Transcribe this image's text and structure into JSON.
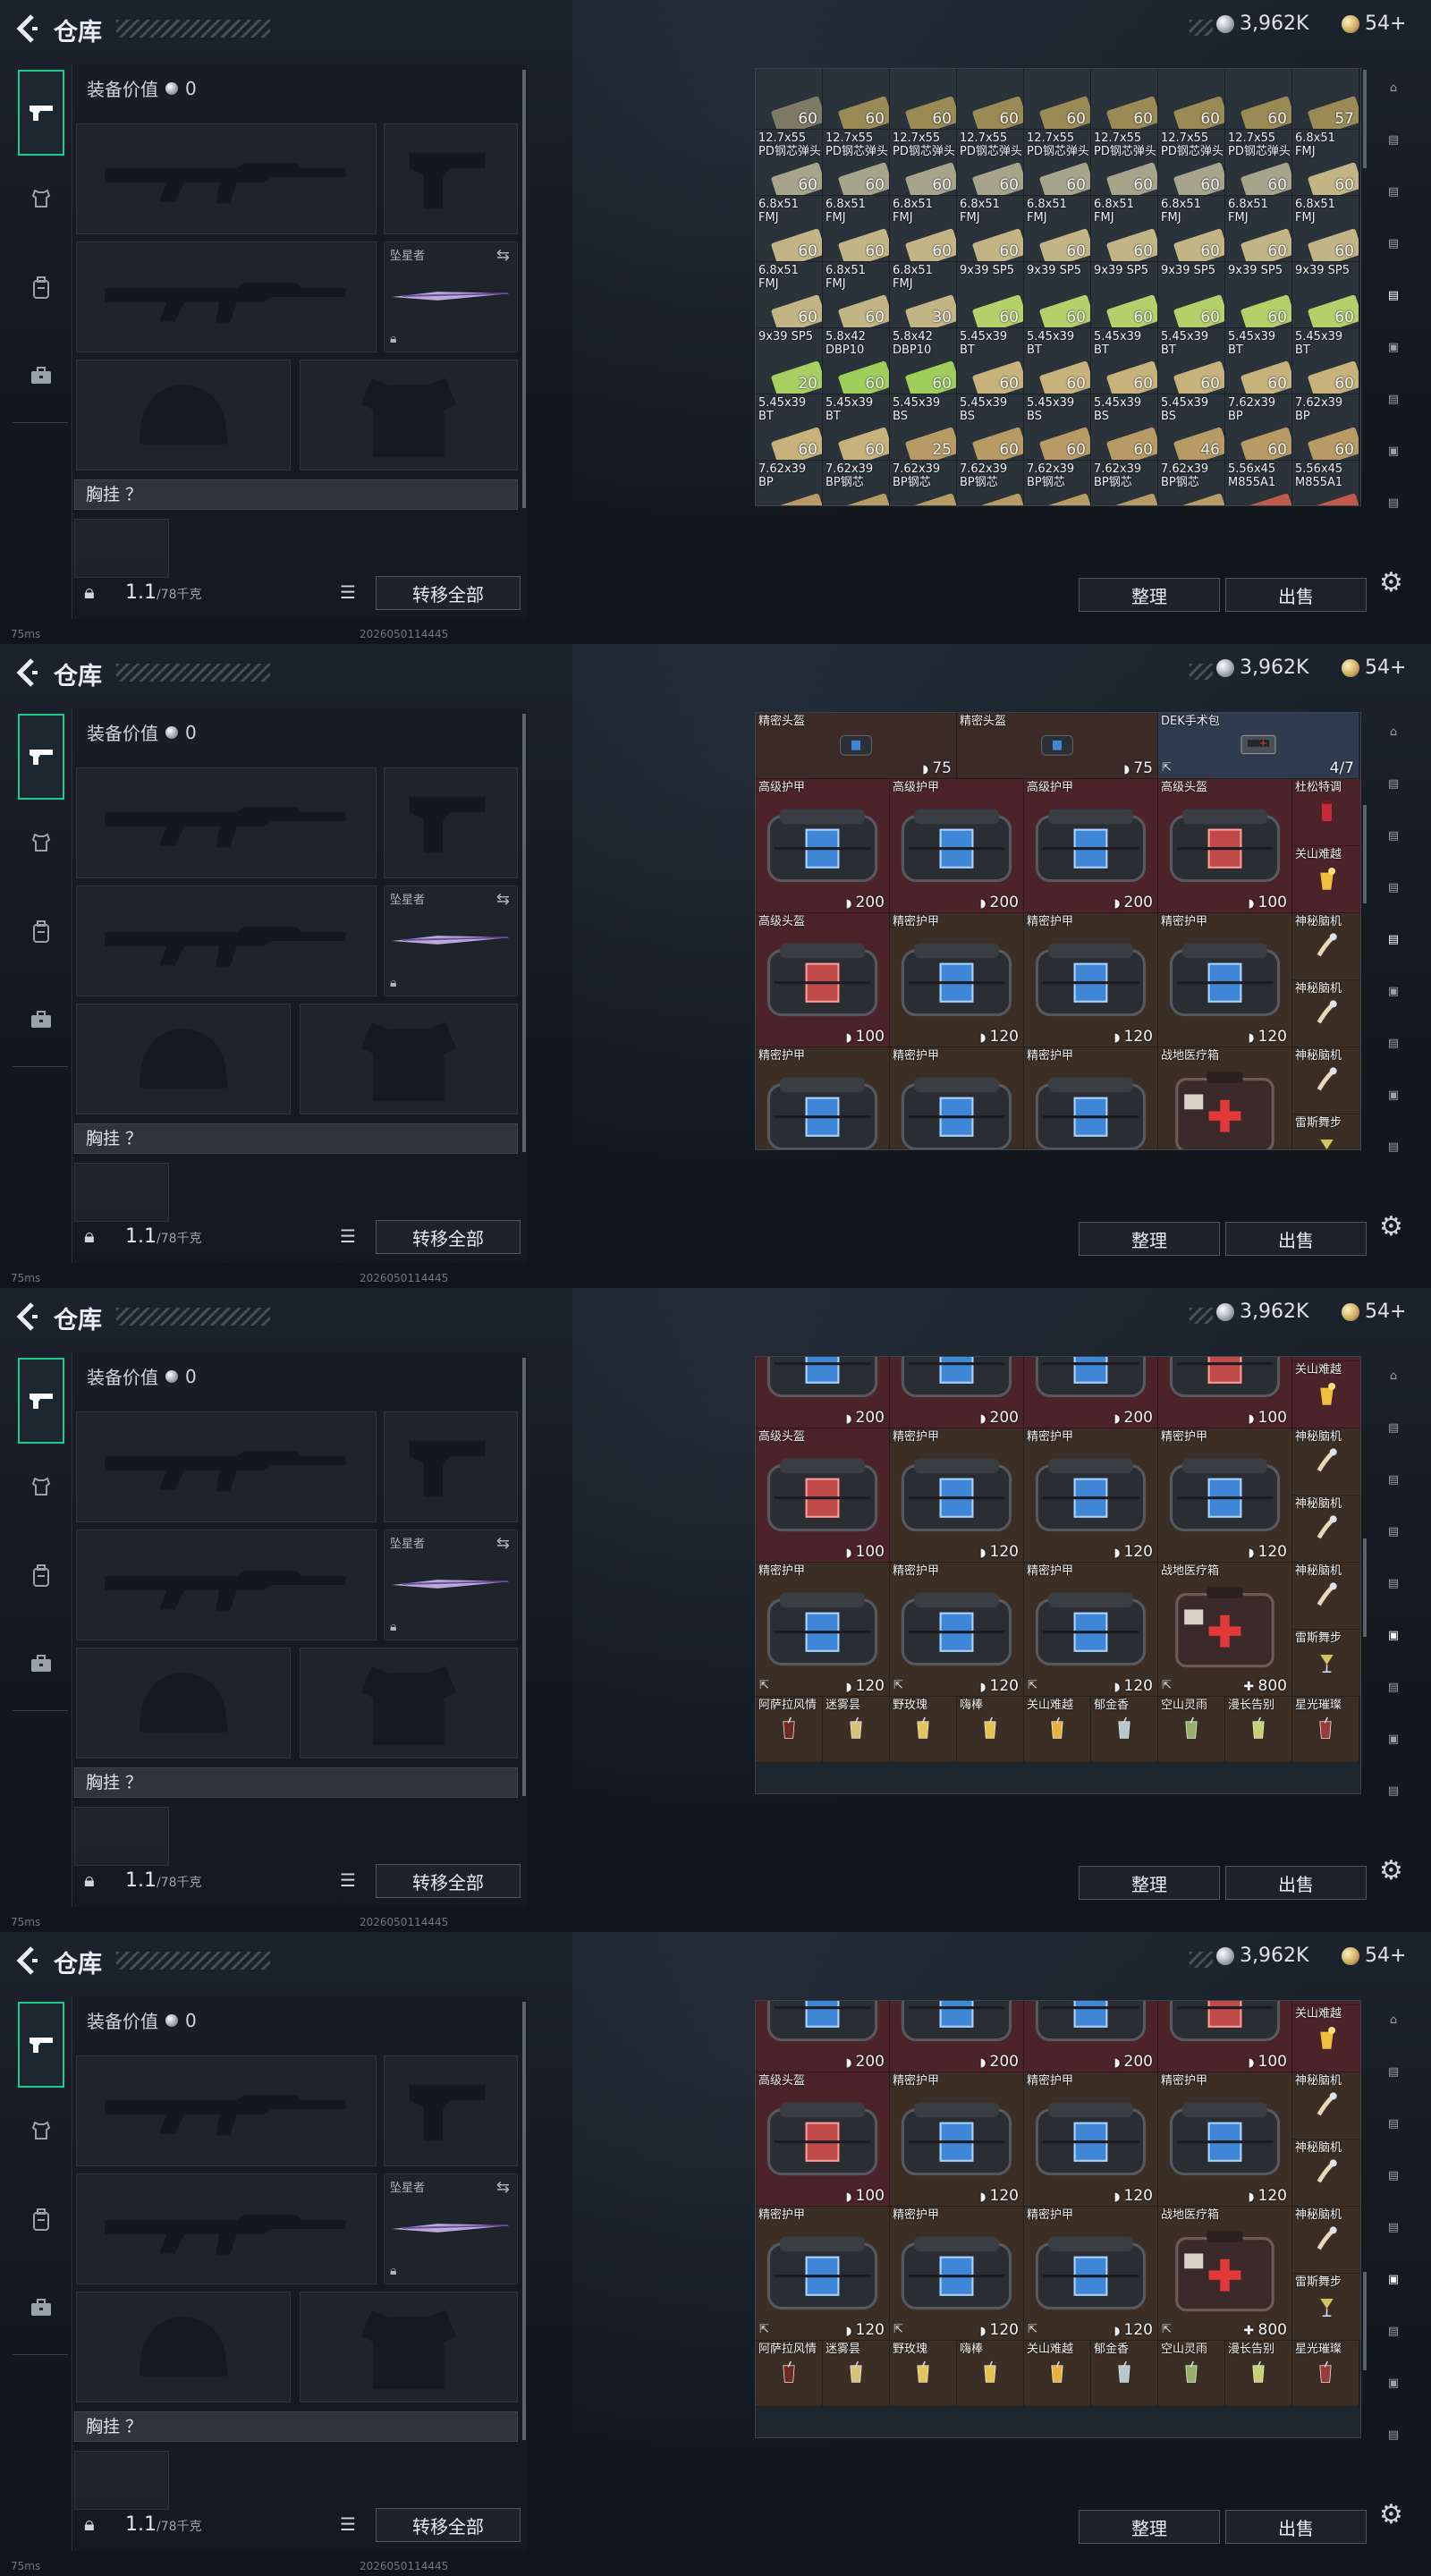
{
  "topbar": {
    "title": "仓库",
    "currency1": "3,962K",
    "currency2": "54+"
  },
  "equipment": {
    "value_label": "装备价值",
    "value": "0",
    "melee_name": "坠星者",
    "chest_label": "胸挂 ？",
    "weight": "1.1",
    "weight_max": "/78千克",
    "transfer_all": "转移全部"
  },
  "status": {
    "ping": "75ms",
    "version": "2026050114445"
  },
  "actions": {
    "sort": "整理",
    "sell": "出售"
  },
  "frames": [
    {
      "grid_kind": "ammo",
      "ammo_rows": [
        [
          {
            "n": "",
            "q": "60",
            "c": "#7d7a66"
          },
          {
            "n": "",
            "q": "60",
            "c": "#9a8a55"
          },
          {
            "n": "",
            "q": "60",
            "c": "#9a8a55"
          },
          {
            "n": "",
            "q": "60",
            "c": "#9a8a55"
          },
          {
            "n": "",
            "q": "60",
            "c": "#9a8a55"
          },
          {
            "n": "",
            "q": "60",
            "c": "#9a8a55"
          },
          {
            "n": "",
            "q": "60",
            "c": "#9a8a55"
          },
          {
            "n": "",
            "q": "60",
            "c": "#9a8a55"
          },
          {
            "n": "",
            "q": "57",
            "c": "#9a8a55"
          }
        ],
        [
          {
            "n": "12.7x55 PD钢芯弹头",
            "q": "60",
            "c": "#a7a48c"
          },
          {
            "n": "12.7x55 PD钢芯弹头",
            "q": "60",
            "c": "#a7a48c"
          },
          {
            "n": "12.7x55 PD钢芯弹头",
            "q": "60",
            "c": "#a7a48c"
          },
          {
            "n": "12.7x55 PD钢芯弹头",
            "q": "60",
            "c": "#a7a48c"
          },
          {
            "n": "12.7x55 PD钢芯弹头",
            "q": "60",
            "c": "#a7a48c"
          },
          {
            "n": "12.7x55 PD钢芯弹头",
            "q": "60",
            "c": "#a7a48c"
          },
          {
            "n": "12.7x55 PD钢芯弹头",
            "q": "60",
            "c": "#a7a48c"
          },
          {
            "n": "12.7x55 PD钢芯弹头",
            "q": "60",
            "c": "#a7a48c"
          },
          {
            "n": "6.8x51 FMJ",
            "q": "60",
            "c": "#c2b484"
          }
        ],
        [
          {
            "n": "6.8x51 FMJ",
            "q": "60",
            "c": "#c2b484"
          },
          {
            "n": "6.8x51 FMJ",
            "q": "60",
            "c": "#c2b484"
          },
          {
            "n": "6.8x51 FMJ",
            "q": "60",
            "c": "#c2b484"
          },
          {
            "n": "6.8x51 FMJ",
            "q": "60",
            "c": "#c2b484"
          },
          {
            "n": "6.8x51 FMJ",
            "q": "60",
            "c": "#c2b484"
          },
          {
            "n": "6.8x51 FMJ",
            "q": "60",
            "c": "#c2b484"
          },
          {
            "n": "6.8x51 FMJ",
            "q": "60",
            "c": "#c2b484"
          },
          {
            "n": "6.8x51 FMJ",
            "q": "60",
            "c": "#c2b484"
          },
          {
            "n": "6.8x51 FMJ",
            "q": "60",
            "c": "#c2b484"
          }
        ],
        [
          {
            "n": "6.8x51 FMJ",
            "q": "60",
            "c": "#c2b484"
          },
          {
            "n": "6.8x51 FMJ",
            "q": "60",
            "c": "#c2b484"
          },
          {
            "n": "6.8x51 FMJ",
            "q": "30",
            "c": "#c2b484"
          },
          {
            "n": "9x39 SP5",
            "q": "60",
            "c": "#b4d06a"
          },
          {
            "n": "9x39 SP5",
            "q": "60",
            "c": "#b4d06a"
          },
          {
            "n": "9x39 SP5",
            "q": "60",
            "c": "#b4d06a"
          },
          {
            "n": "9x39 SP5",
            "q": "60",
            "c": "#b4d06a"
          },
          {
            "n": "9x39 SP5",
            "q": "60",
            "c": "#b4d06a"
          },
          {
            "n": "9x39 SP5",
            "q": "60",
            "c": "#b4d06a"
          }
        ],
        [
          {
            "n": "9x39 SP5",
            "q": "20",
            "c": "#a7cf62"
          },
          {
            "n": "5.8x42 DBP10",
            "q": "60",
            "c": "#9fcf5a"
          },
          {
            "n": "5.8x42 DBP10",
            "q": "60",
            "c": "#9fcf5a"
          },
          {
            "n": "5.45x39 BT",
            "q": "60",
            "c": "#c6b27a"
          },
          {
            "n": "5.45x39 BT",
            "q": "60",
            "c": "#c6b27a"
          },
          {
            "n": "5.45x39 BT",
            "q": "60",
            "c": "#c6b27a"
          },
          {
            "n": "5.45x39 BT",
            "q": "60",
            "c": "#c6b27a"
          },
          {
            "n": "5.45x39 BT",
            "q": "60",
            "c": "#c6b27a"
          },
          {
            "n": "5.45x39 BT",
            "q": "60",
            "c": "#c6b27a"
          }
        ],
        [
          {
            "n": "5.45x39 BT",
            "q": "60",
            "c": "#c6b27a"
          },
          {
            "n": "5.45x39 BT",
            "q": "60",
            "c": "#c6b27a"
          },
          {
            "n": "5.45x39 BS",
            "q": "25",
            "c": "#b79a64"
          },
          {
            "n": "5.45x39 BS",
            "q": "60",
            "c": "#b79a64"
          },
          {
            "n": "5.45x39 BS",
            "q": "60",
            "c": "#b79a64"
          },
          {
            "n": "5.45x39 BS",
            "q": "60",
            "c": "#b79a64"
          },
          {
            "n": "5.45x39 BS",
            "q": "46",
            "c": "#b79a64"
          },
          {
            "n": "7.62x39 BP",
            "q": "60",
            "c": "#b79a64"
          },
          {
            "n": "7.62x39 BP",
            "q": "60",
            "c": "#b79a64"
          }
        ],
        [
          {
            "n": "7.62x39 BP",
            "q": "30",
            "c": "#b79a64"
          },
          {
            "n": "7.62x39 BP钢芯",
            "q": "60",
            "c": "#b79a64"
          },
          {
            "n": "7.62x39 BP钢芯",
            "q": "60",
            "c": "#b79a64"
          },
          {
            "n": "7.62x39 BP钢芯",
            "q": "60",
            "c": "#b79a64"
          },
          {
            "n": "7.62x39 BP钢芯",
            "q": "60",
            "c": "#b79a64"
          },
          {
            "n": "7.62x39 BP钢芯",
            "q": "60",
            "c": "#b79a64"
          },
          {
            "n": "7.62x39 BP钢芯",
            "q": "60",
            "c": "#b79a64"
          },
          {
            "n": "5.56x45 M855A1",
            "q": "60",
            "c": "#c05a4a"
          },
          {
            "n": "5.56x45 M855A1",
            "q": "60",
            "c": "#c05a4a"
          }
        ]
      ]
    },
    {
      "grid_kind": "gear",
      "offset": 0
    },
    {
      "grid_kind": "gear",
      "offset": 1
    },
    {
      "grid_kind": "gear",
      "offset": 2
    }
  ],
  "gear_items": {
    "row0": [
      {
        "n": "精密头盔",
        "q": "75",
        "type": "bag",
        "bg": "#3b2b26",
        "w": 2
      },
      {
        "n": "精密头盔",
        "q": "75",
        "type": "bag",
        "bg": "#3b2b26",
        "w": 2
      },
      {
        "n": "DEK手术包",
        "q": "4/7",
        "type": "kit",
        "bg": "#313b4f",
        "w": 2
      }
    ],
    "row1": [
      {
        "n": "高级护甲",
        "q": "200",
        "type": "armor",
        "bg": "#4b2329",
        "w": 2,
        "h": 2
      },
      {
        "n": "高级护甲",
        "q": "200",
        "type": "armor",
        "bg": "#4b2329",
        "w": 2,
        "h": 2
      },
      {
        "n": "高级护甲",
        "q": "200",
        "type": "armor",
        "bg": "#4b2329",
        "w": 2,
        "h": 2
      },
      {
        "n": "高级头盔",
        "q": "100",
        "type": "helmet",
        "bg": "#4b2329",
        "w": 2,
        "h": 2
      }
    ],
    "row2": [
      {
        "n": "高级头盔",
        "q": "100",
        "type": "helmet",
        "bg": "#4b2329",
        "w": 2,
        "h": 2
      },
      {
        "n": "精密护甲",
        "q": "120",
        "type": "armor",
        "bg": "#3b2e24",
        "w": 2,
        "h": 2
      },
      {
        "n": "精密护甲",
        "q": "120",
        "type": "armor",
        "bg": "#3b2e24",
        "w": 2,
        "h": 2
      },
      {
        "n": "精密护甲",
        "q": "120",
        "type": "armor",
        "bg": "#3b2e24",
        "w": 2,
        "h": 2
      }
    ],
    "row3": [
      {
        "n": "精密护甲",
        "q": "120",
        "type": "armor",
        "bg": "#3b2e24",
        "w": 2,
        "h": 2
      },
      {
        "n": "精密护甲",
        "q": "120",
        "type": "armor",
        "bg": "#3b2e24",
        "w": 2,
        "h": 2
      },
      {
        "n": "精密护甲",
        "q": "120",
        "type": "armor",
        "bg": "#3b2e24",
        "w": 2,
        "h": 2
      },
      {
        "n": "战地医疗箱",
        "q": "800",
        "type": "med",
        "bg": "#3b2e24",
        "w": 2,
        "h": 2
      }
    ],
    "side": [
      {
        "n": "杜松特调",
        "type": "red"
      },
      {
        "n": "关山难越",
        "type": "yellow"
      },
      {
        "n": "神秘脑机",
        "type": "hand"
      },
      {
        "n": "神秘脑机",
        "type": "hand"
      },
      {
        "n": "神秘脑机",
        "type": "hand"
      },
      {
        "n": "雷斯舞步",
        "type": "cocktail"
      }
    ],
    "drinks": [
      {
        "n": "阿萨拉风情",
        "c": "#6e2a1e"
      },
      {
        "n": "迷雾昙",
        "c": "#d8c27a"
      },
      {
        "n": "野玫瑰",
        "c": "#e2c65a"
      },
      {
        "n": "嗨棒",
        "c": "#e6c44c"
      },
      {
        "n": "关山难越",
        "c": "#e8b23c"
      },
      {
        "n": "郁金香",
        "c": "#b7c7cf"
      },
      {
        "n": "空山灵雨",
        "c": "#96b066"
      },
      {
        "n": "漫长告别",
        "c": "#c9d070"
      },
      {
        "n": "星光璀璨",
        "c": "#9a3a38"
      }
    ]
  },
  "icons": {
    "back": "back-chevron-icon",
    "pistol": "pistol-icon",
    "armor": "armor-icon",
    "backpack": "backpack-icon",
    "briefcase": "briefcase-icon",
    "lock": "lock-icon",
    "list": "list-icon",
    "settings": "gear-icon",
    "swap": "swap-icon"
  }
}
